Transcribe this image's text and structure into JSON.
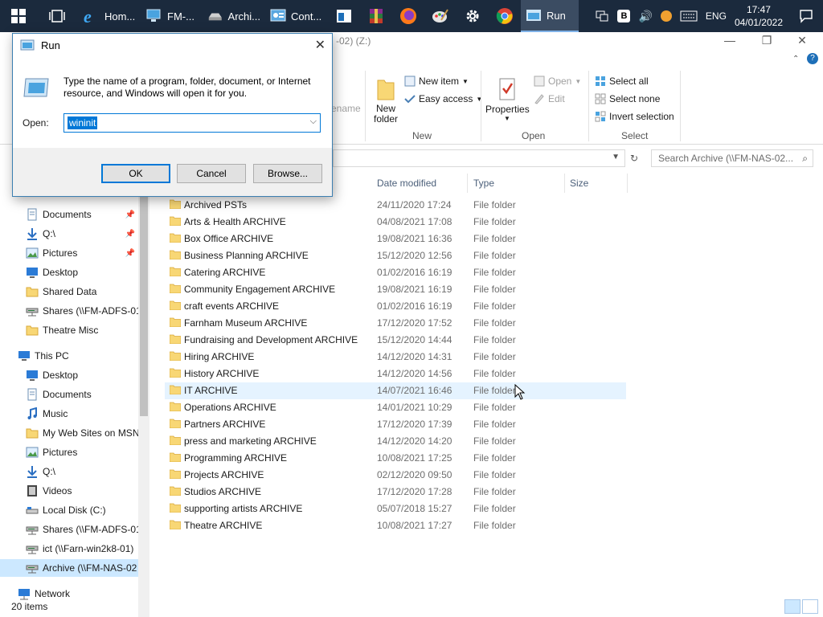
{
  "taskbar": {
    "apps": [
      {
        "label": "Hom...",
        "icon": "ie-icon"
      },
      {
        "label": "FM-...",
        "icon": "computer-icon"
      },
      {
        "label": "Archi...",
        "icon": "drive-icon"
      },
      {
        "label": "Cont...",
        "icon": "control-panel-icon"
      }
    ],
    "run_label": "Run",
    "tray": {
      "b_badge": "B",
      "lang": "ENG",
      "time": "17:47",
      "date": "04/01/2022"
    }
  },
  "explorer": {
    "title": "-02) (Z:)",
    "ribbon": {
      "partial_label": "ename",
      "new_folder": "New\nfolder",
      "new_item": "New item",
      "easy_access": "Easy access",
      "properties": "Properties",
      "open": "Open",
      "edit": "Edit",
      "select_all": "Select all",
      "select_none": "Select none",
      "invert_selection": "Invert selection",
      "group_new": "New",
      "group_open": "Open",
      "group_select": "Select"
    },
    "search_placeholder": "Search Archive (\\\\FM-NAS-02...",
    "columns": {
      "date": "Date modified",
      "type": "Type",
      "size": "Size"
    },
    "nav": [
      {
        "label": "Documents",
        "icon": "documents-icon",
        "pinned": true
      },
      {
        "label": "Q:\\",
        "icon": "download-arrow-icon",
        "pinned": true
      },
      {
        "label": "Pictures",
        "icon": "pictures-icon",
        "pinned": true
      },
      {
        "label": "Desktop",
        "icon": "desktop-icon",
        "pinned": false
      },
      {
        "label": "Shared Data",
        "icon": "folder-icon",
        "pinned": false
      },
      {
        "label": "Shares (\\\\FM-ADFS-01",
        "icon": "network-drive-icon",
        "pinned": false
      },
      {
        "label": "Theatre Misc",
        "icon": "folder-icon",
        "pinned": false
      },
      {
        "label": "This PC",
        "icon": "this-pc-icon",
        "pinned": false,
        "top": true
      },
      {
        "label": "Desktop",
        "icon": "desktop-icon",
        "pinned": false
      },
      {
        "label": "Documents",
        "icon": "documents-icon",
        "pinned": false
      },
      {
        "label": "Music",
        "icon": "music-icon",
        "pinned": false
      },
      {
        "label": "My Web Sites on MSN",
        "icon": "folder-icon",
        "pinned": false
      },
      {
        "label": "Pictures",
        "icon": "pictures-icon",
        "pinned": false
      },
      {
        "label": "Q:\\",
        "icon": "download-arrow-icon",
        "pinned": false
      },
      {
        "label": "Videos",
        "icon": "videos-icon",
        "pinned": false
      },
      {
        "label": "Local Disk (C:)",
        "icon": "local-disk-icon",
        "pinned": false
      },
      {
        "label": "Shares (\\\\FM-ADFS-01",
        "icon": "network-drive-icon",
        "pinned": false
      },
      {
        "label": "ict (\\\\Farn-win2k8-01)",
        "icon": "network-drive-icon",
        "pinned": false
      },
      {
        "label": "Archive (\\\\FM-NAS-02",
        "icon": "network-drive-icon",
        "pinned": false,
        "selected": true
      },
      {
        "label": "Network",
        "icon": "network-icon",
        "pinned": false,
        "top": true
      }
    ],
    "files": [
      {
        "name": "Archived PSTs",
        "date": "24/11/2020 17:24",
        "type": "File folder"
      },
      {
        "name": "Arts & Health ARCHIVE",
        "date": "04/08/2021 17:08",
        "type": "File folder"
      },
      {
        "name": "Box Office ARCHIVE",
        "date": "19/08/2021 16:36",
        "type": "File folder"
      },
      {
        "name": "Business Planning ARCHIVE",
        "date": "15/12/2020 12:56",
        "type": "File folder"
      },
      {
        "name": "Catering ARCHIVE",
        "date": "01/02/2016 16:19",
        "type": "File folder"
      },
      {
        "name": "Community Engagement ARCHIVE",
        "date": "19/08/2021 16:19",
        "type": "File folder"
      },
      {
        "name": "craft events ARCHIVE",
        "date": "01/02/2016 16:19",
        "type": "File folder"
      },
      {
        "name": "Farnham Museum ARCHIVE",
        "date": "17/12/2020 17:52",
        "type": "File folder"
      },
      {
        "name": "Fundraising and Development ARCHIVE",
        "date": "15/12/2020 14:44",
        "type": "File folder"
      },
      {
        "name": "Hiring ARCHIVE",
        "date": "14/12/2020 14:31",
        "type": "File folder"
      },
      {
        "name": "History ARCHIVE",
        "date": "14/12/2020 14:56",
        "type": "File folder"
      },
      {
        "name": "IT ARCHIVE",
        "date": "14/07/2021 16:46",
        "type": "File folder",
        "hover": true
      },
      {
        "name": "Operations ARCHIVE",
        "date": "14/01/2021 10:29",
        "type": "File folder"
      },
      {
        "name": "Partners ARCHIVE",
        "date": "17/12/2020 17:39",
        "type": "File folder"
      },
      {
        "name": "press and marketing ARCHIVE",
        "date": "14/12/2020 14:20",
        "type": "File folder"
      },
      {
        "name": "Programming ARCHIVE",
        "date": "10/08/2021 17:25",
        "type": "File folder"
      },
      {
        "name": "Projects ARCHIVE",
        "date": "02/12/2020 09:50",
        "type": "File folder"
      },
      {
        "name": "Studios ARCHIVE",
        "date": "17/12/2020 17:28",
        "type": "File folder"
      },
      {
        "name": "supporting artists ARCHIVE",
        "date": "05/07/2018 15:27",
        "type": "File folder"
      },
      {
        "name": "Theatre ARCHIVE",
        "date": "10/08/2021 17:27",
        "type": "File folder"
      }
    ],
    "status": "20 items"
  },
  "run_dialog": {
    "title": "Run",
    "prompt": "Type the name of a program, folder, document, or Internet resource, and Windows will open it for you.",
    "open_label": "Open:",
    "open_value": "wininit",
    "ok": "OK",
    "cancel": "Cancel",
    "browse": "Browse..."
  },
  "colors": {
    "taskbar": "#1b2a3d",
    "accent": "#0078d7",
    "folder": "#f8d775",
    "selection": "#cce8ff"
  }
}
